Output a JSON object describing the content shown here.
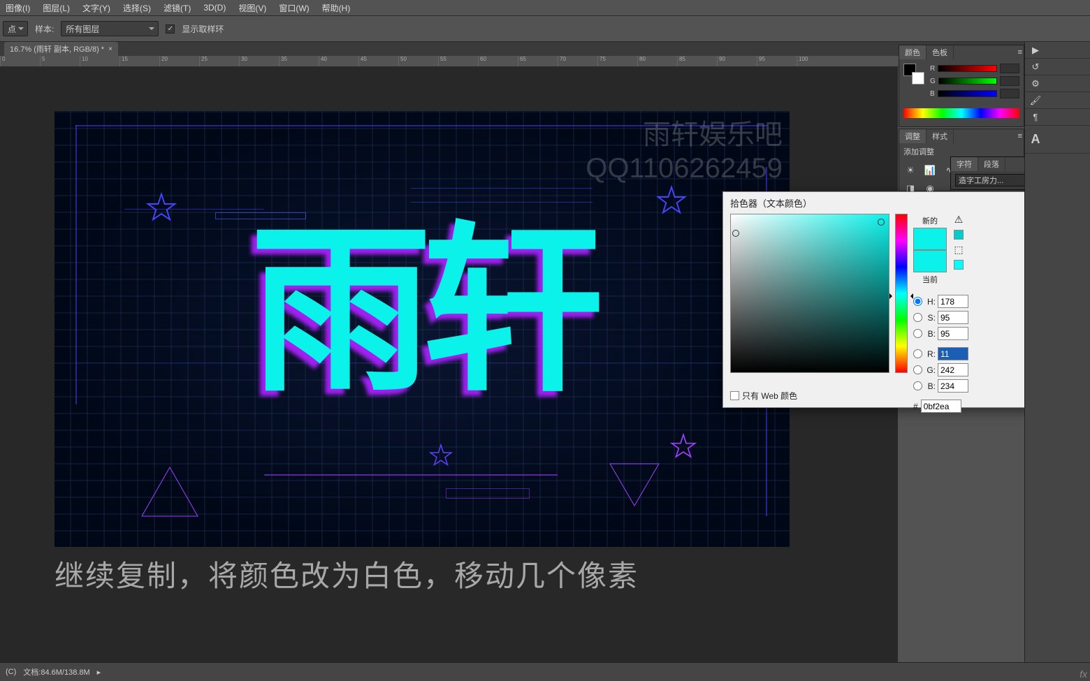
{
  "menu": [
    "图像(I)",
    "图层(L)",
    "文字(Y)",
    "选择(S)",
    "滤镜(T)",
    "3D(D)",
    "视图(V)",
    "窗口(W)",
    "帮助(H)"
  ],
  "options": {
    "sample_mode": "点",
    "sample_label": "样本:",
    "sample_layers": "所有图层",
    "show_ring_label": "显示取样环"
  },
  "doc_tab": "16.7% (雨轩 副本, RGB/8) *",
  "ruler_marks": [
    "0",
    "5",
    "10",
    "15",
    "20",
    "25",
    "30",
    "35",
    "40",
    "45",
    "50",
    "55",
    "60",
    "65",
    "70",
    "75",
    "80",
    "85",
    "90",
    "95",
    "100"
  ],
  "canvas_text": "雨轩",
  "watermark": {
    "line1": "雨轩娱乐吧",
    "line2": "QQ1106262459"
  },
  "subtitle": "继续复制，将颜色改为白色，移动几个像素",
  "color_panel": {
    "tabs": [
      "颜色",
      "色板"
    ],
    "channels": [
      "R",
      "G",
      "B"
    ],
    "r": "",
    "g": "",
    "b": ""
  },
  "adjust_panel": {
    "tabs": [
      "调整",
      "样式"
    ],
    "hint": "添加调整"
  },
  "char_panel": {
    "tabs": [
      "字符",
      "段落"
    ],
    "font": "造字工房力...",
    "style": "-"
  },
  "colorpicker": {
    "title": "拾色器（文本颜色）",
    "new_label": "新的",
    "current_label": "当前",
    "new_color": "#0bf2ea",
    "current_color": "#0bf2ea",
    "H": "178",
    "S": "95",
    "B": "95",
    "R": "11",
    "G": "242",
    "B2": "234",
    "hex": "0bf2ea",
    "hex_prefix": "#",
    "web_only": "只有 Web 颜色"
  },
  "status": {
    "copyright": "(C)",
    "doc_label": "文档:",
    "doc_size": "84.6M/138.8M"
  }
}
